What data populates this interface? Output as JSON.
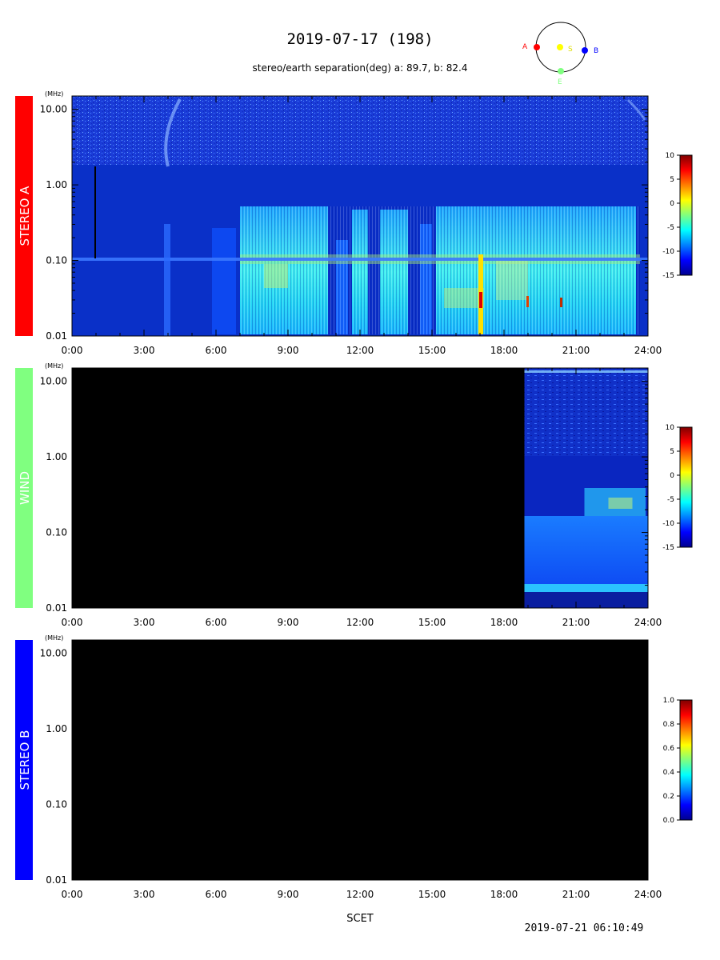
{
  "header": {
    "title": "2019-07-17 (198)",
    "subtitle": "stereo/earth separation(deg) a:  89.7, b:  82.4"
  },
  "orbit_diagram": {
    "labels": {
      "a": "A",
      "s": "S",
      "b": "B",
      "e": "E"
    },
    "colors": {
      "a": "#ff0000",
      "s": "#ffff00",
      "b": "#0000ff",
      "e": "#80ff80"
    }
  },
  "footer": {
    "xlabel": "SCET",
    "timestamp": "2019-07-21 06:10:49"
  },
  "chart_data": [
    {
      "type": "heatmap",
      "instrument": "STEREO A",
      "instrument_color": "#ff0000",
      "y_unit": "(MHz)",
      "y_scale": "log",
      "ylim": [
        0.01,
        15
      ],
      "y_ticks": [
        "10.00",
        "1.00",
        "0.10",
        "0.01"
      ],
      "xlim": [
        "0:00",
        "24:00"
      ],
      "x_ticks": [
        "0:00",
        "3:00",
        "6:00",
        "9:00",
        "12:00",
        "15:00",
        "18:00",
        "21:00",
        "24:00"
      ],
      "data_coverage_hours": [
        0,
        24
      ],
      "colorbar": {
        "range": [
          -15,
          10
        ],
        "ticks": [
          "10",
          "5",
          "0",
          "-5",
          "-10",
          "-15"
        ]
      }
    },
    {
      "type": "heatmap",
      "instrument": "WIND",
      "instrument_color": "#80ff80",
      "y_unit": "(MHz)",
      "y_scale": "log",
      "ylim": [
        0.01,
        15
      ],
      "y_ticks": [
        "10.00",
        "1.00",
        "0.10",
        "0.01"
      ],
      "xlim": [
        "0:00",
        "24:00"
      ],
      "x_ticks": [
        "0:00",
        "3:00",
        "6:00",
        "9:00",
        "12:00",
        "15:00",
        "18:00",
        "21:00",
        "24:00"
      ],
      "data_coverage_hours": [
        18.85,
        24
      ],
      "colorbar": {
        "range": [
          -15,
          10
        ],
        "ticks": [
          "10",
          "5",
          "0",
          "-5",
          "-10",
          "-15"
        ]
      }
    },
    {
      "type": "heatmap",
      "instrument": "STEREO B",
      "instrument_color": "#0000ff",
      "y_unit": "(MHz)",
      "y_scale": "log",
      "ylim": [
        0.01,
        15
      ],
      "y_ticks": [
        "10.00",
        "1.00",
        "0.10",
        "0.01"
      ],
      "xlim": [
        "0:00",
        "24:00"
      ],
      "x_ticks": [
        "0:00",
        "3:00",
        "6:00",
        "9:00",
        "12:00",
        "15:00",
        "18:00",
        "21:00",
        "24:00"
      ],
      "data_coverage_hours": [],
      "colorbar": {
        "range": [
          0,
          1
        ],
        "ticks": [
          "1.0",
          "0.8",
          "0.6",
          "0.4",
          "0.2",
          "0.0"
        ]
      }
    }
  ]
}
